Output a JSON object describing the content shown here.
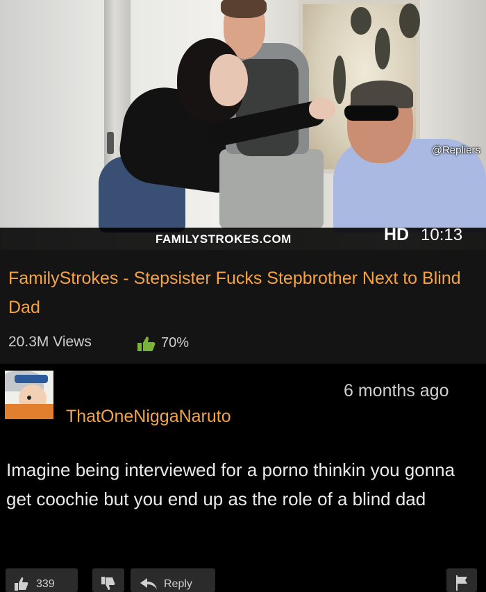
{
  "thumbnail": {
    "watermark": "@Repliers",
    "site_label": "FAMILYSTROKES.COM",
    "quality": "HD",
    "duration": "10:13"
  },
  "video": {
    "title": "FamilyStrokes - Stepsister Fucks Stepbrother Next to Blind Dad",
    "views": "20.3M Views",
    "rating": "70%"
  },
  "comment": {
    "username": "ThatOneNiggaNaruto",
    "timestamp": "6 months ago",
    "text": "Imagine being interviewed for a porno thinkin you gonna get coochie but you end up as the role of a blind dad",
    "like_count": "339",
    "reply_label": "Reply"
  },
  "colors": {
    "accent": "#f5a343",
    "background": "#141414",
    "comment_background": "#000000",
    "thumbs_up": "#7bb33a"
  },
  "icons": {
    "rating": "thumbs-up-icon",
    "like": "thumbs-up-icon",
    "dislike": "thumbs-down-icon",
    "reply": "reply-arrow-icon",
    "flag": "flag-icon"
  }
}
